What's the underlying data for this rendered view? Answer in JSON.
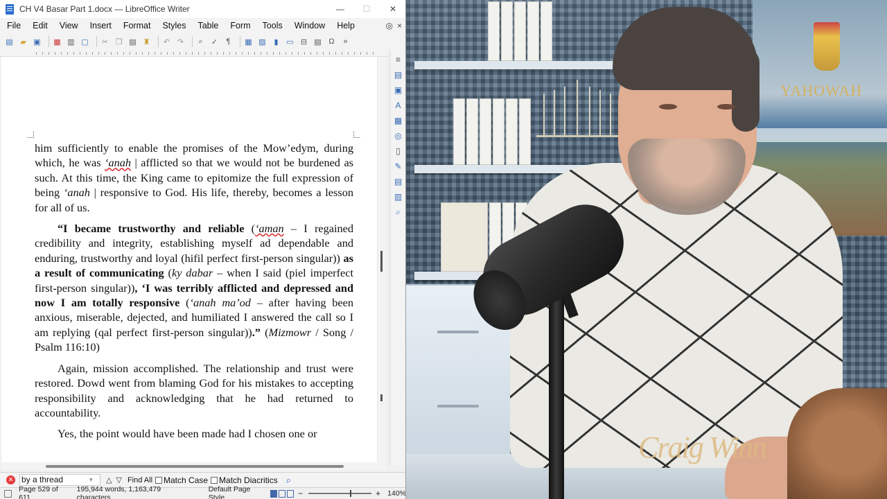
{
  "window": {
    "title": "CH V4 Basar Part 1.docx — LibreOffice Writer",
    "minimize": "—",
    "maximize": "☐",
    "close": "✕"
  },
  "menubar": {
    "items": [
      "File",
      "Edit",
      "View",
      "Insert",
      "Format",
      "Styles",
      "Table",
      "Form",
      "Tools",
      "Window",
      "Help"
    ],
    "right_icon": "globe-icon",
    "right_close": "×"
  },
  "document": {
    "paragraphs": [
      {
        "indent": false,
        "runs": [
          {
            "t": "him sufficiently to enable the promises of the Mow’edym, during which, he was ",
            "s": ""
          },
          {
            "t": "‘anah",
            "s": "ital ul"
          },
          {
            "t": " | afflicted so that we would not be burdened as such. At this time, the King came to epitomize the full expression of being ",
            "s": ""
          },
          {
            "t": "‘anah",
            "s": "ital"
          },
          {
            "t": " | responsive to God. His life, thereby, becomes a lesson for all of us.",
            "s": ""
          }
        ]
      },
      {
        "indent": true,
        "runs": [
          {
            "t": "“I became trustworthy and reliable",
            "s": "bold"
          },
          {
            "t": " (",
            "s": ""
          },
          {
            "t": "‘aman",
            "s": "ital ul"
          },
          {
            "t": " – I regained credibility and integrity, establishing myself ad dependable and enduring, trustworthy and loyal (hifil perfect first-person singular)) ",
            "s": ""
          },
          {
            "t": "as a result of communicating",
            "s": "bold"
          },
          {
            "t": " (",
            "s": ""
          },
          {
            "t": "ky dabar",
            "s": "ital"
          },
          {
            "t": " – when I said (piel imperfect first-person singular))",
            "s": ""
          },
          {
            "t": ", ‘I was terribly afflicted and depressed and now I am totally responsive",
            "s": "bold"
          },
          {
            "t": " (",
            "s": ""
          },
          {
            "t": "‘anah ma’od",
            "s": "ital"
          },
          {
            "t": " – after having been anxious, miserable, dejected, and humiliated I answered the call so I am replying (qal perfect first-person singular))",
            "s": ""
          },
          {
            "t": ".”",
            "s": "bold"
          },
          {
            "t": " (",
            "s": ""
          },
          {
            "t": "Mizmowr",
            "s": "ital"
          },
          {
            "t": " / Song / Psalm 116:10)",
            "s": ""
          }
        ]
      },
      {
        "indent": true,
        "runs": [
          {
            "t": "Again, mission accomplished. The relationship and trust were restored. Dowd went from blaming God for his mistakes to accepting responsibility and acknowledging that he had returned to accountability.",
            "s": ""
          }
        ]
      },
      {
        "indent": true,
        "runs": [
          {
            "t": "Yes, the point would have been made had I chosen one or",
            "s": ""
          }
        ]
      }
    ]
  },
  "findbar": {
    "search_value": "by a thread",
    "find_all": "Find All",
    "match_case": "Match Case",
    "match_diacritics": "Match Diacritics"
  },
  "statusbar": {
    "page": "Page 529 of 611",
    "words": "195,944 words, 1,163,479 characters",
    "page_style": "Default Page Style",
    "zoom_minus": "−",
    "zoom_plus": "+",
    "zoom": "140%"
  },
  "video": {
    "logo_text": "YAHOWAH",
    "signature": "Craig Winn"
  }
}
